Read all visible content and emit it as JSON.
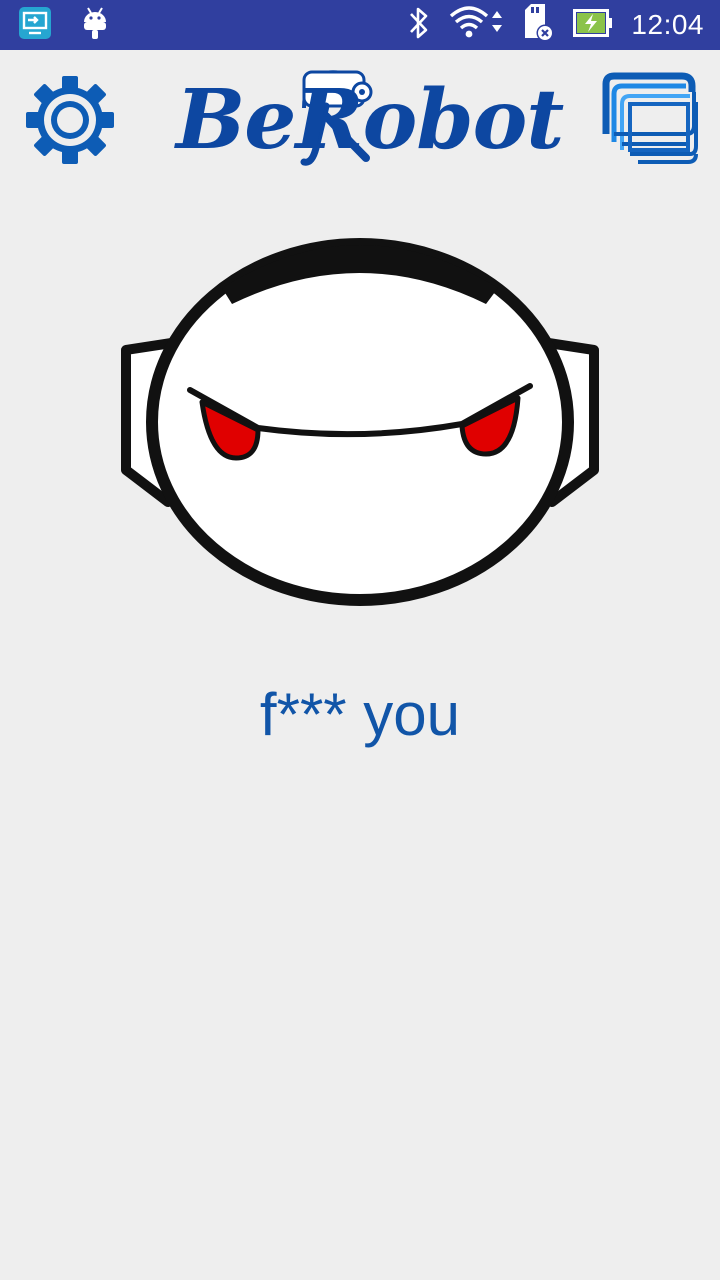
{
  "status_bar": {
    "time": "12:04",
    "background_color": "#303f9f",
    "icons_left": [
      "cast-screen-icon",
      "android-debug-icon"
    ],
    "icons_right": [
      "bluetooth-icon",
      "wifi-icon",
      "sd-card-icon",
      "battery-charging-icon"
    ]
  },
  "header": {
    "logo_text": "BeRobot",
    "settings_icon": "gear-icon",
    "windows_icon": "stacked-windows-icon",
    "accent_color": "#0d5cb5"
  },
  "robot_face": {
    "expression": "angry",
    "eye_color": "#e00000"
  },
  "speech": {
    "text": "f*** you",
    "color": "#1155a8"
  }
}
